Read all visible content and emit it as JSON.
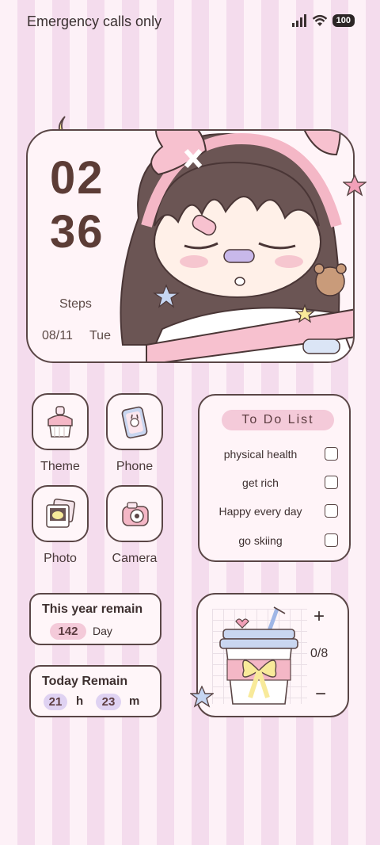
{
  "status_bar": {
    "carrier": "Emergency calls only",
    "battery": "100",
    "icons": [
      "signal-icon",
      "wifi-icon",
      "battery-icon"
    ]
  },
  "clock_widget": {
    "hours": "02",
    "minutes": "36",
    "steps_label": "Steps",
    "date": "08/11",
    "day": "Tue"
  },
  "apps": [
    {
      "label": "Theme",
      "icon": "theme-icon"
    },
    {
      "label": "Phone",
      "icon": "phone-icon"
    },
    {
      "label": "Photo",
      "icon": "photo-icon"
    },
    {
      "label": "Camera",
      "icon": "camera-icon"
    }
  ],
  "todo": {
    "title": "To Do List",
    "items": [
      {
        "text": "physical health",
        "checked": false
      },
      {
        "text": "get rich",
        "checked": false
      },
      {
        "text": "Happy every day",
        "checked": false
      },
      {
        "text": "go skiing",
        "checked": false
      }
    ]
  },
  "year_remain": {
    "title": "This year remain",
    "value": "142",
    "unit": "Day"
  },
  "today_remain": {
    "title": "Today Remain",
    "hours": "21",
    "hours_unit": "h",
    "minutes": "23",
    "minutes_unit": "m"
  },
  "water": {
    "plus": "+",
    "count": "0/8",
    "minus": "−"
  },
  "colors": {
    "accent_pink": "#f4cad9",
    "accent_lavender": "#dfd2f2",
    "outline": "#5a4646",
    "stripe_light": "#fdf1f7",
    "stripe_dark": "#f4dced"
  }
}
